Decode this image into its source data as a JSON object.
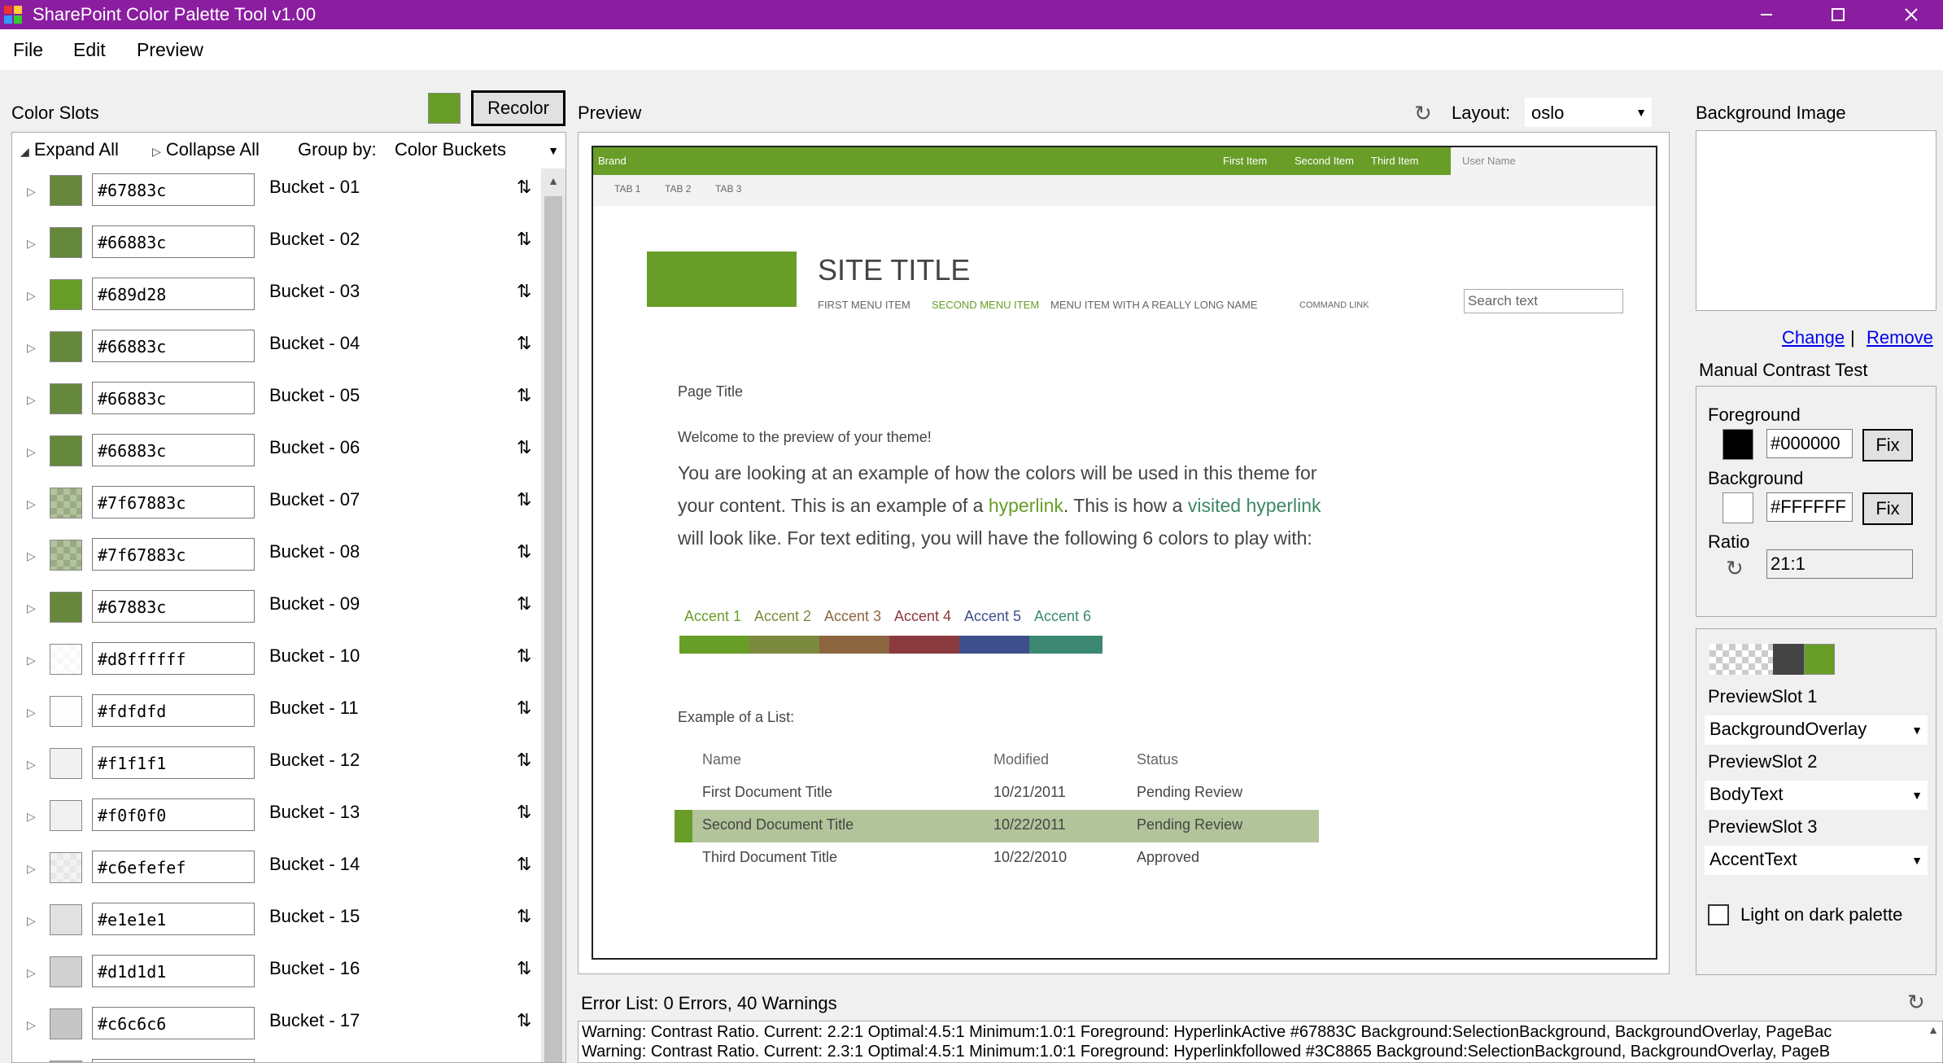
{
  "window": {
    "title": "SharePoint Color Palette Tool v1.00",
    "accent": "#8b1ea0"
  },
  "menu": [
    "File",
    "Edit",
    "Preview"
  ],
  "color_slots": {
    "label": "Color Slots",
    "current_swatch": "#689d28",
    "recolor_label": "Recolor",
    "expand_all": "Expand All",
    "collapse_all": "Collapse All",
    "group_by_label": "Group by:",
    "group_by_value": "Color Buckets",
    "rows": [
      {
        "hex": "#67883c",
        "name": "Bucket - 01",
        "color": "#67883c",
        "alpha": false
      },
      {
        "hex": "#66883c",
        "name": "Bucket - 02",
        "color": "#66883c",
        "alpha": false
      },
      {
        "hex": "#689d28",
        "name": "Bucket - 03",
        "color": "#689d28",
        "alpha": false
      },
      {
        "hex": "#66883c",
        "name": "Bucket - 04",
        "color": "#66883c",
        "alpha": false
      },
      {
        "hex": "#66883c",
        "name": "Bucket - 05",
        "color": "#66883c",
        "alpha": false
      },
      {
        "hex": "#66883c",
        "name": "Bucket - 06",
        "color": "#66883c",
        "alpha": false
      },
      {
        "hex": "#7f67883c",
        "name": "Bucket - 07",
        "color": "rgba(103,136,60,0.5)",
        "alpha": true
      },
      {
        "hex": "#7f67883c",
        "name": "Bucket - 08",
        "color": "rgba(103,136,60,0.5)",
        "alpha": true
      },
      {
        "hex": "#67883c",
        "name": "Bucket - 09",
        "color": "#67883c",
        "alpha": false
      },
      {
        "hex": "#d8ffffff",
        "name": "Bucket - 10",
        "color": "rgba(255,255,255,0.85)",
        "alpha": true
      },
      {
        "hex": "#fdfdfd",
        "name": "Bucket - 11",
        "color": "#fdfdfd",
        "alpha": false
      },
      {
        "hex": "#f1f1f1",
        "name": "Bucket - 12",
        "color": "#f1f1f1",
        "alpha": false
      },
      {
        "hex": "#f0f0f0",
        "name": "Bucket - 13",
        "color": "#f0f0f0",
        "alpha": false
      },
      {
        "hex": "#c6efefef",
        "name": "Bucket - 14",
        "color": "rgba(239,239,239,0.78)",
        "alpha": true
      },
      {
        "hex": "#e1e1e1",
        "name": "Bucket - 15",
        "color": "#e1e1e1",
        "alpha": false
      },
      {
        "hex": "#d1d1d1",
        "name": "Bucket - 16",
        "color": "#d1d1d1",
        "alpha": false
      },
      {
        "hex": "#c6c6c6",
        "name": "Bucket - 17",
        "color": "#c6c6c6",
        "alpha": false
      },
      {
        "hex": "",
        "name": "",
        "color": "#b4b4b4",
        "alpha": false
      }
    ]
  },
  "preview": {
    "label": "Preview",
    "layout_label": "Layout:",
    "layout_value": "oslo",
    "brand": "Brand",
    "suite_items": [
      "First Item",
      "Second Item",
      "Third Item"
    ],
    "user_name": "User Name",
    "tabs": [
      "TAB 1",
      "TAB 2",
      "TAB 3"
    ],
    "site_title": "SITE TITLE",
    "nav": [
      "FIRST MENU ITEM",
      "SECOND MENU ITEM",
      "MENU ITEM WITH A REALLY LONG NAME",
      "COMMAND LINK"
    ],
    "search_placeholder": "Search text",
    "page_title": "Page Title",
    "welcome": "Welcome to the preview of your theme!",
    "para": {
      "p1": "You are looking at an example of how the colors will be used in this theme for your content. This is an example of a ",
      "link": "hyperlink",
      "p2": ". This is how a ",
      "visited": "visited hyperlink",
      "p3": " will look like. For text editing, you will have the following 6 colors to play with:"
    },
    "accents": [
      {
        "label": "Accent 1",
        "color": "#689d28"
      },
      {
        "label": "Accent 2",
        "color": "#7b8a3e"
      },
      {
        "label": "Accent 3",
        "color": "#8c6640"
      },
      {
        "label": "Accent 4",
        "color": "#8b3a3e"
      },
      {
        "label": "Accent 5",
        "color": "#3e4f8c"
      },
      {
        "label": "Accent 6",
        "color": "#3c8872"
      }
    ],
    "list_title": "Example of a List:",
    "list_headers": [
      "Name",
      "Modified",
      "Status"
    ],
    "list_rows": [
      {
        "name": "First Document Title",
        "modified": "10/21/2011",
        "status": "Pending Review"
      },
      {
        "name": "Second Document Title",
        "modified": "10/22/2011",
        "status": "Pending Review"
      },
      {
        "name": "Third Document Title",
        "modified": "10/22/2010",
        "status": "Approved"
      }
    ]
  },
  "right": {
    "bg_image_label": "Background Image",
    "change": "Change",
    "separator": "|",
    "remove": "Remove",
    "contrast_title": "Manual Contrast Test",
    "foreground_label": "Foreground",
    "foreground_value": "#000000",
    "background_label": "Background",
    "background_value": "#FFFFFF",
    "fix_label": "Fix",
    "ratio_label": "Ratio",
    "ratio_value": "21:1",
    "slot1_label": "PreviewSlot 1",
    "slot1_value": "BackgroundOverlay",
    "slot2_label": "PreviewSlot 2",
    "slot2_value": "BodyText",
    "slot3_label": "PreviewSlot 3",
    "slot3_value": "AccentText",
    "light_on_dark": "Light on dark palette"
  },
  "errors": {
    "title": "Error List: 0 Errors, 40 Warnings",
    "lines": [
      "Warning: Contrast Ratio. Current: 2.2:1 Optimal:4.5:1 Minimum:1.0:1 Foreground: HyperlinkActive #67883C Background:SelectionBackground, BackgroundOverlay, PageBac",
      "Warning: Contrast Ratio. Current: 2.3:1 Optimal:4.5:1 Minimum:1.0:1 Foreground: Hyperlinkfollowed #3C8865 Background:SelectionBackground, BackgroundOverlay, PageB"
    ]
  }
}
